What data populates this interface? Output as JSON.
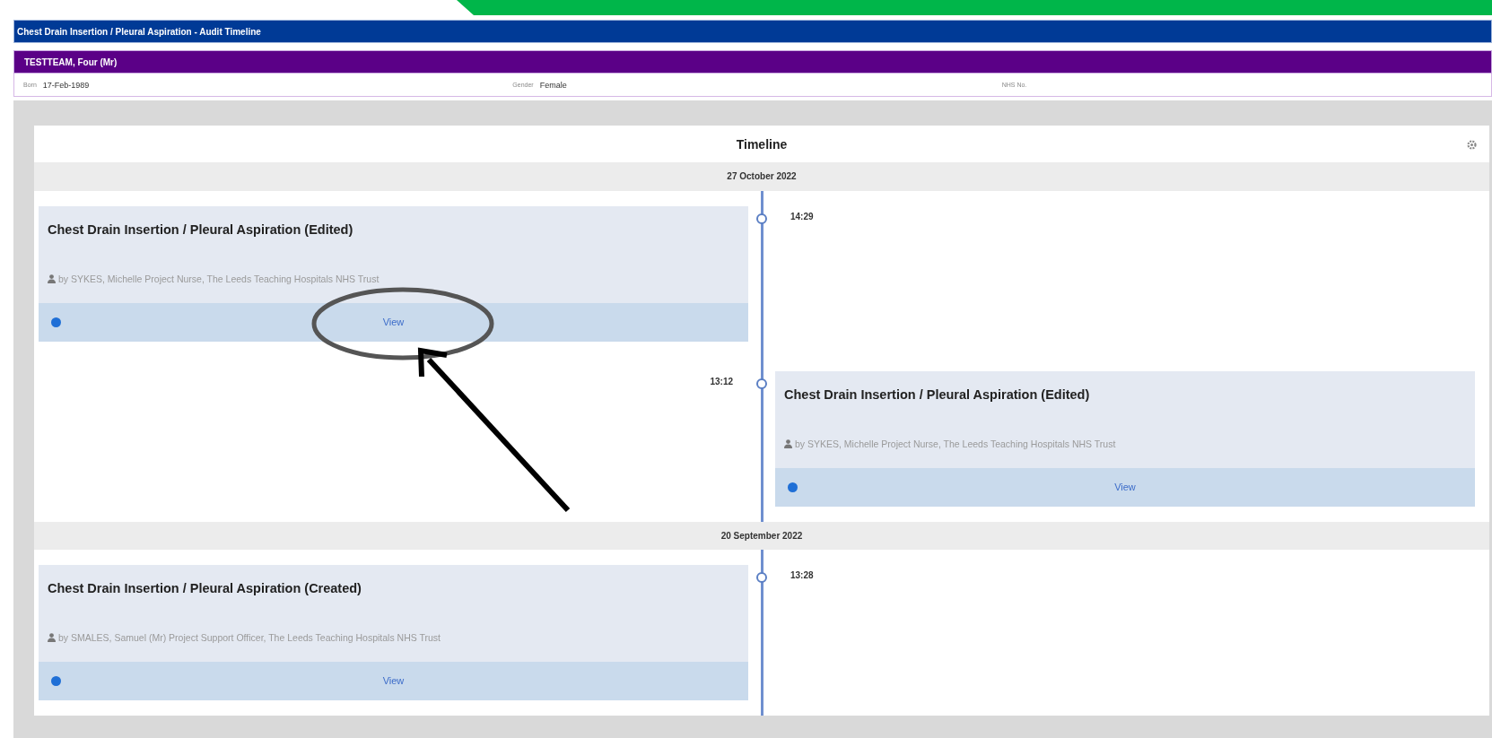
{
  "window": {
    "title": "Chest Drain Insertion / Pleural Aspiration - Audit Timeline"
  },
  "patient": {
    "name": "TESTTEAM, Four (Mr)",
    "fields": [
      {
        "label": "Born",
        "value": "17-Feb-1989"
      },
      {
        "label": "Gender",
        "value": "Female"
      },
      {
        "label": "NHS No."
      }
    ]
  },
  "timeline": {
    "title": "Timeline",
    "groups": [
      {
        "date": "27 October 2022",
        "events": [
          {
            "kind": "left",
            "time": "14:29",
            "title": "Chest Drain Insertion / Pleural Aspiration (Edited)",
            "author": "by SYKES, Michelle Project Nurse, The Leeds Teaching Hospitals NHS Trust",
            "action": "View"
          },
          {
            "kind": "right",
            "time": "13:12",
            "title": "Chest Drain Insertion / Pleural Aspiration (Edited)",
            "author": "by SYKES, Michelle Project Nurse, The Leeds Teaching Hospitals NHS Trust",
            "action": "View"
          }
        ]
      },
      {
        "date": "20 September 2022",
        "events": [
          {
            "kind": "left",
            "time": "13:28",
            "title": "Chest Drain Insertion / Pleural Aspiration (Created)",
            "author": "by SMALES, Samuel (Mr) Project Support Officer, The Leeds Teaching Hospitals NHS Trust",
            "action": "View"
          }
        ]
      }
    ]
  }
}
